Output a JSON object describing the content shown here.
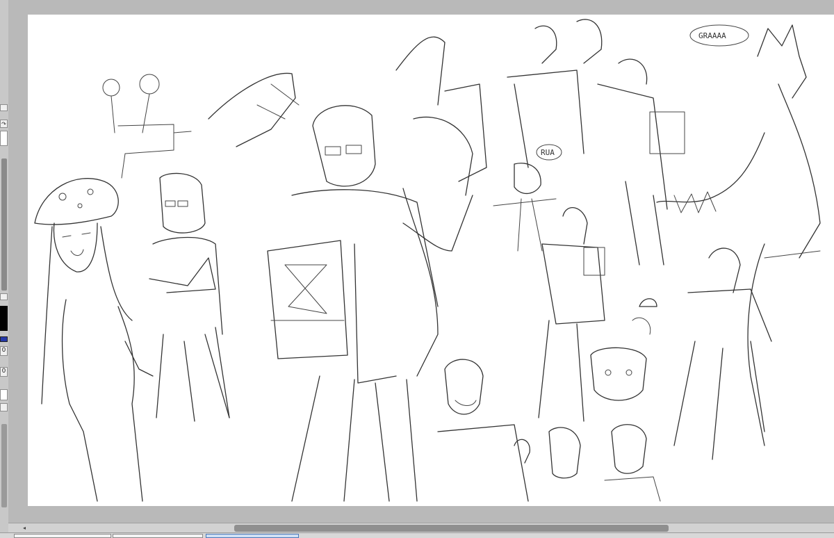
{
  "canvas": {
    "speech_bubbles": [
      {
        "text": "GRAAAA"
      },
      {
        "text": "RUA"
      }
    ]
  },
  "left_panel": {
    "values": [
      "0",
      "0"
    ]
  },
  "icons": {
    "refresh": "rotate-arrow-icon",
    "scroll_left": "triangle-left-icon"
  }
}
